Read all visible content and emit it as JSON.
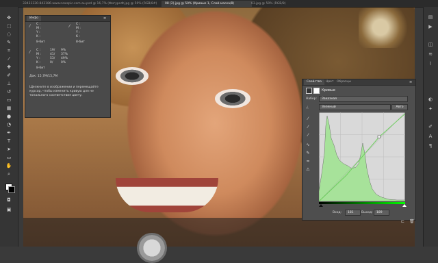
{
  "tabs": [
    {
      "label": "33431330-843186-www.newspic.com.au.psd @ 16,7% (Фигура 2, RGB/8#)"
    },
    {
      "label": "Ф.jpg @ 50% (RGB/8#)"
    },
    {
      "label": "08 (2).jpg @ 50% (Кривые 1, Слой-маска/8)"
    },
    {
      "label": "03.jpg @ 50% (RGB/8)"
    }
  ],
  "info_panel": {
    "tab": "Инфо",
    "rows": [
      {
        "l": "C :",
        "r": "C :"
      },
      {
        "l": "M :",
        "r": "M :"
      },
      {
        "l": "Y :",
        "r": "Y :"
      },
      {
        "l": "K :",
        "r": "K :"
      },
      {
        "l": "8-бит",
        "r": "8-бит"
      }
    ],
    "rgb": [
      {
        "label": "C :",
        "a": "19/",
        "b": "9%"
      },
      {
        "label": "M :",
        "a": "41/",
        "b": "37%"
      },
      {
        "label": "Y :",
        "a": "53/",
        "b": "49%"
      },
      {
        "label": "K :",
        "a": "0/",
        "b": "0%"
      }
    ],
    "bit_left": "8-бит",
    "doc": "Док: 15,7М/15,7М",
    "hint": "Щелкните в изображении и перемещайте курсор, чтобы изменить кривую для не тонального соответствия цвету."
  },
  "properties_panel": {
    "tabs": [
      "Свойства",
      "Цвет",
      "Образцы"
    ],
    "title": "Кривые",
    "preset_label": "Набор:",
    "preset_value": "Заказная",
    "channel_value": "Зеленый",
    "auto_button": "Авто",
    "input_label": "Вход:",
    "input_value": "181",
    "output_label": "Выход:",
    "output_value": "189"
  },
  "colors": {
    "curve": "#6fcf60",
    "histogram": "#a7e29a"
  }
}
